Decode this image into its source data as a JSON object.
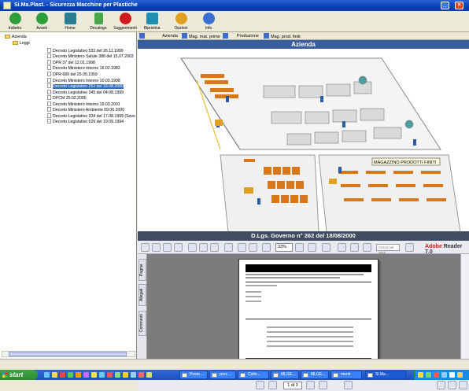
{
  "window": {
    "title": "Si.Ma.Plast. - Sicurezza Macchine per Plastiche"
  },
  "toolbar": {
    "buttons": [
      {
        "label": "Indietro",
        "icon": "back-arrow-icon",
        "color": "#2e9d3a"
      },
      {
        "label": "Avanti",
        "icon": "forward-arrow-icon",
        "color": "#2e9d3a"
      },
      {
        "label": "Home",
        "icon": "home-icon",
        "color": "#2c7d8f"
      },
      {
        "label": "Decalogo",
        "icon": "decalogo-icon",
        "color": "#4aa84a"
      },
      {
        "label": "Suggerimenti",
        "icon": "help-icon",
        "color": "#cc1d1d"
      },
      {
        "label": "Ripristina",
        "icon": "restore-icon",
        "color": "#1d8fb0"
      },
      {
        "label": "Opzioni",
        "icon": "options-icon",
        "color": "#e0a020"
      },
      {
        "label": "Info",
        "icon": "info-icon",
        "color": "#3a6ed0"
      }
    ]
  },
  "tree": {
    "root": "Azienda",
    "folder": "Leggi",
    "items": [
      "Decreto Legislativo 532 del 26.11.1999",
      "Decreto Ministero Salute 388 del 15.07.2003",
      "DPR 37 del 12.01.1998",
      "Decreto Ministero Interno 16.02.1982",
      "DPR 689 del 25.05.1959",
      "Decreto Ministero Interno 10.03.1998",
      "Decreto Legislativo 262 del 18.08.2000",
      "Decreto Legislativo 345 del 04.08.1999",
      "DPCM 25.02.2005",
      "Decreto Ministero Interno 19.03.2001",
      "Decreto Ministero Ambiente 09.06.2000",
      "Decreto Legislativo 334 del 17.08.1999 (Seve",
      "Decreto Legislativo 626 del 19.09.1994"
    ],
    "selected_index": 6
  },
  "tabs": [
    "Azienda",
    "Mag. mat. prime",
    "Produzione",
    "Mag. prod. finiti"
  ],
  "banner": "Azienda",
  "plant": {
    "warehouse_label": "MAGAZZINO PRODOTTI FINITI"
  },
  "document": {
    "banner": "D.Lgs. Governo n° 262 del 18/08/2000",
    "zoom": "33%",
    "search_placeholder": "Cerca nel Web",
    "adobe_brand": "Adobe",
    "adobe_product": "Reader",
    "adobe_version": "7.0",
    "side_tabs": [
      "Pagine",
      "Allegati",
      "Commenti"
    ],
    "page_indicator": "1 di 3"
  },
  "taskbar": {
    "start_label": "start",
    "tasks": [
      "Posta ...",
      "prez ...",
      "Collo...",
      "MLGE...",
      "MLGE...",
      "menti",
      "Si.Ma..."
    ]
  },
  "colors": {
    "title_blue": "#0a3fb5",
    "banner_blue": "#3a5e9c",
    "doc_banner": "#3f4c62",
    "shelf_orange": "#d9781a",
    "selection": "#316ac5"
  }
}
